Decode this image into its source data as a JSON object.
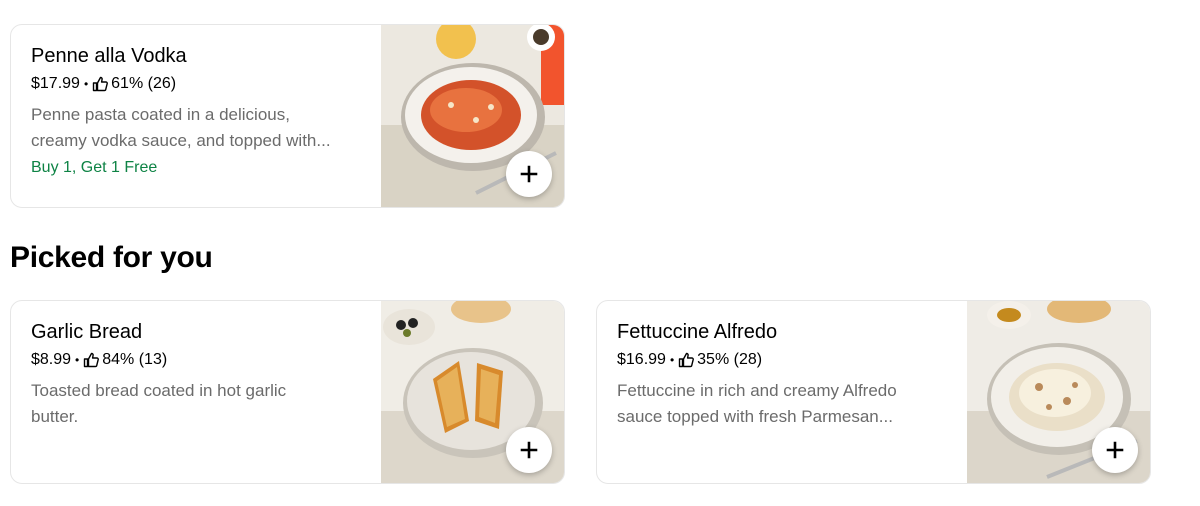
{
  "featured": {
    "name": "Penne alla Vodka",
    "price": "$17.99",
    "separator": "•",
    "rating": "61% (26)",
    "description_lines": [
      "Penne pasta coated in a delicious,",
      "creamy vodka sauce, and topped with..."
    ],
    "promo": "Buy 1, Get 1 Free",
    "add_icon": "plus-icon",
    "like_icon": "thumbs-up-icon"
  },
  "picked_section": {
    "title": "Picked for you",
    "items": [
      {
        "name": "Garlic Bread",
        "price": "$8.99",
        "separator": "•",
        "rating": "84% (13)",
        "description_lines": [
          "Toasted bread coated in hot garlic",
          "butter."
        ]
      },
      {
        "name": "Fettuccine Alfredo",
        "price": "$16.99",
        "separator": "•",
        "rating": "35% (28)",
        "description_lines": [
          "Fettuccine in rich and creamy Alfredo",
          "sauce topped with fresh Parmesan..."
        ]
      }
    ]
  },
  "colors": {
    "promo_green": "#0e8345",
    "desc_gray": "#6b6b6b",
    "card_border": "#e6e6e6"
  }
}
